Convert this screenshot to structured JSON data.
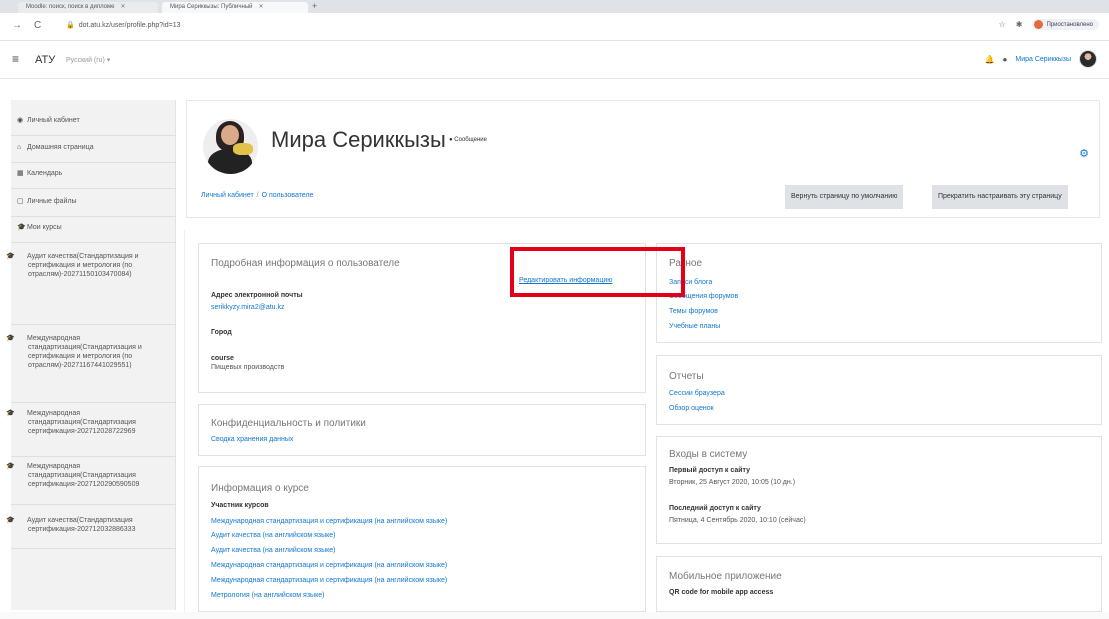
{
  "browser": {
    "tabs": [
      {
        "label": "Moodle: поиск, поиск в дипломе"
      },
      {
        "label": "Мира Сериккызы: Публичный"
      }
    ],
    "url": "dot.atu.kz/user/profile.php?id=13",
    "profile_label": "Приостановлено"
  },
  "navbar": {
    "brand": "АТУ",
    "language": "Русский (ru) ▾",
    "user_name": "Мира Сериккызы"
  },
  "sidebar": {
    "items": [
      {
        "label": "Личный кабинет",
        "icon": "dashboard-icon"
      },
      {
        "label": "Домашняя страница",
        "icon": "home-icon"
      },
      {
        "label": "Календарь",
        "icon": "calendar-icon"
      },
      {
        "label": "Личные файлы",
        "icon": "file-icon"
      },
      {
        "label": "Мои курсы",
        "icon": "graduation-cap-icon"
      }
    ],
    "courses": [
      {
        "label": "Аудит качества(Стандартизация и сертификация и метрология (по отраслям)-20271150103470084)"
      },
      {
        "label": "Международная стандартизация(Стандартизация и сертификация и метрология (по отраслям)-20271167441029551)"
      },
      {
        "label": "Международная стандартизация(Стандартизация сертификация-202712028722969"
      },
      {
        "label": "Международная стандартизация(Стандартизация сертификация-2027120290590509"
      },
      {
        "label": "Аудит качества(Стандартизация сертификация-202712032886333"
      }
    ]
  },
  "header": {
    "user_full_name": "Мира Сериккызы",
    "message_label": "Сообщение",
    "breadcrumb": [
      "Личный кабинет",
      "О пользователе"
    ],
    "reset_button": "Вернуть страницу по умолчанию",
    "stop_customizing_button": "Прекратить настраивать эту страницу"
  },
  "details": {
    "title": "Подробная информация о пользователе",
    "edit_link": "Редактировать информацию",
    "email_label": "Адрес электронной почты",
    "email_value": "serikkyzy.mira2@atu.kz",
    "city_label": "Город",
    "course_label": "course",
    "course_value": "Пищевых производств"
  },
  "privacy": {
    "title": "Конфиденциальность и политики",
    "link": "Сводка хранения данных"
  },
  "course_info": {
    "title": "Информация о курсе",
    "label": "Участник курсов",
    "courses": [
      "Международная стандартизация и сертификация (на английском языке)",
      "Аудит качества (на английском языке)",
      "Аудит качества (на английском языке)",
      "Международная стандартизация и сертификация (на английском языке)",
      "Международная стандартизация и сертификация (на английском языке)",
      "Метрология (на английском языке)"
    ]
  },
  "misc": {
    "title": "Разное",
    "links": [
      "Записи блога",
      "Сообщения форумов",
      "Темы форумов",
      "Учебные планы"
    ]
  },
  "reports": {
    "title": "Отчеты",
    "links": [
      "Сессии браузера",
      "Обзор оценок"
    ]
  },
  "logins": {
    "title": "Входы в систему",
    "first_label": "Первый доступ к сайту",
    "first_value": "Вторник, 25 Август 2020, 10:05  (10 дн.)",
    "last_label": "Последний доступ к сайту",
    "last_value": "Пятница, 4 Сентябрь 2020, 10:10  (сейчас)"
  },
  "mobile": {
    "title": "Мобильное приложение",
    "qr_label": "QR code for mobile app access"
  },
  "colors": {
    "link": "#1177d1",
    "highlight": "#e30016"
  }
}
